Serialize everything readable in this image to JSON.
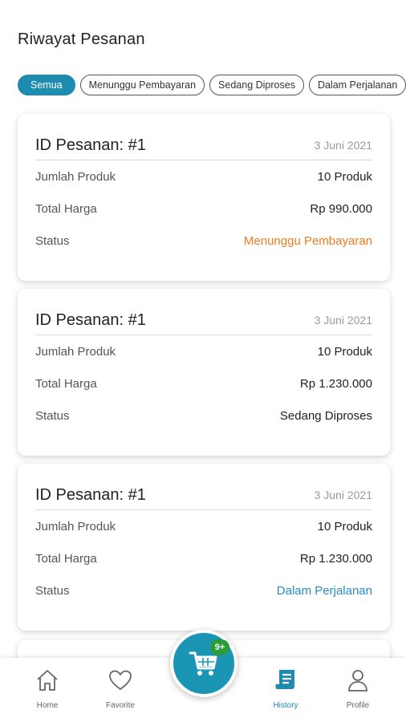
{
  "header": {
    "title": "Riwayat Pesanan"
  },
  "filters": [
    {
      "label": "Semua",
      "active": true
    },
    {
      "label": "Menunggu Pembayaran",
      "active": false
    },
    {
      "label": "Sedang Diproses",
      "active": false
    },
    {
      "label": "Dalam Perjalanan",
      "active": false
    }
  ],
  "orders": [
    {
      "id_label": "ID Pesanan: #1",
      "date": "3 Juni 2021",
      "qty_label": "Jumlah Produk",
      "qty_value": "10 Produk",
      "total_label": "Total Harga",
      "total_value": "Rp 990.000",
      "status_label": "Status",
      "status_value": "Menunggu Pembayaran",
      "status_color": "#f07b1d"
    },
    {
      "id_label": "ID Pesanan: #1",
      "date": "3 Juni 2021",
      "qty_label": "Jumlah Produk",
      "qty_value": "10 Produk",
      "total_label": "Total Harga",
      "total_value": "Rp 1.230.000",
      "status_label": "Status",
      "status_value": "Sedang Diproses",
      "status_color": "#222222"
    },
    {
      "id_label": "ID Pesanan: #1",
      "date": "3 Juni 2021",
      "qty_label": "Jumlah Produk",
      "qty_value": "10 Produk",
      "total_label": "Total Harga",
      "total_value": "Rp 1.230.000",
      "status_label": "Status",
      "status_value": "Dalam Perjalanan",
      "status_color": "#2a8cc4"
    }
  ],
  "nav": {
    "home": {
      "label": "Home",
      "icon": "home-icon"
    },
    "favorite": {
      "label": "Favorite",
      "icon": "heart-icon"
    },
    "cart": {
      "badge": "9+",
      "icon": "cart-icon"
    },
    "history": {
      "label": "History",
      "icon": "receipt-icon",
      "active": true
    },
    "profile": {
      "label": "Profile",
      "icon": "user-icon"
    }
  },
  "colors": {
    "accent": "#1e8bb0",
    "badge": "#2a9d3a",
    "pending": "#f07b1d",
    "shipping": "#2a8cc4"
  }
}
